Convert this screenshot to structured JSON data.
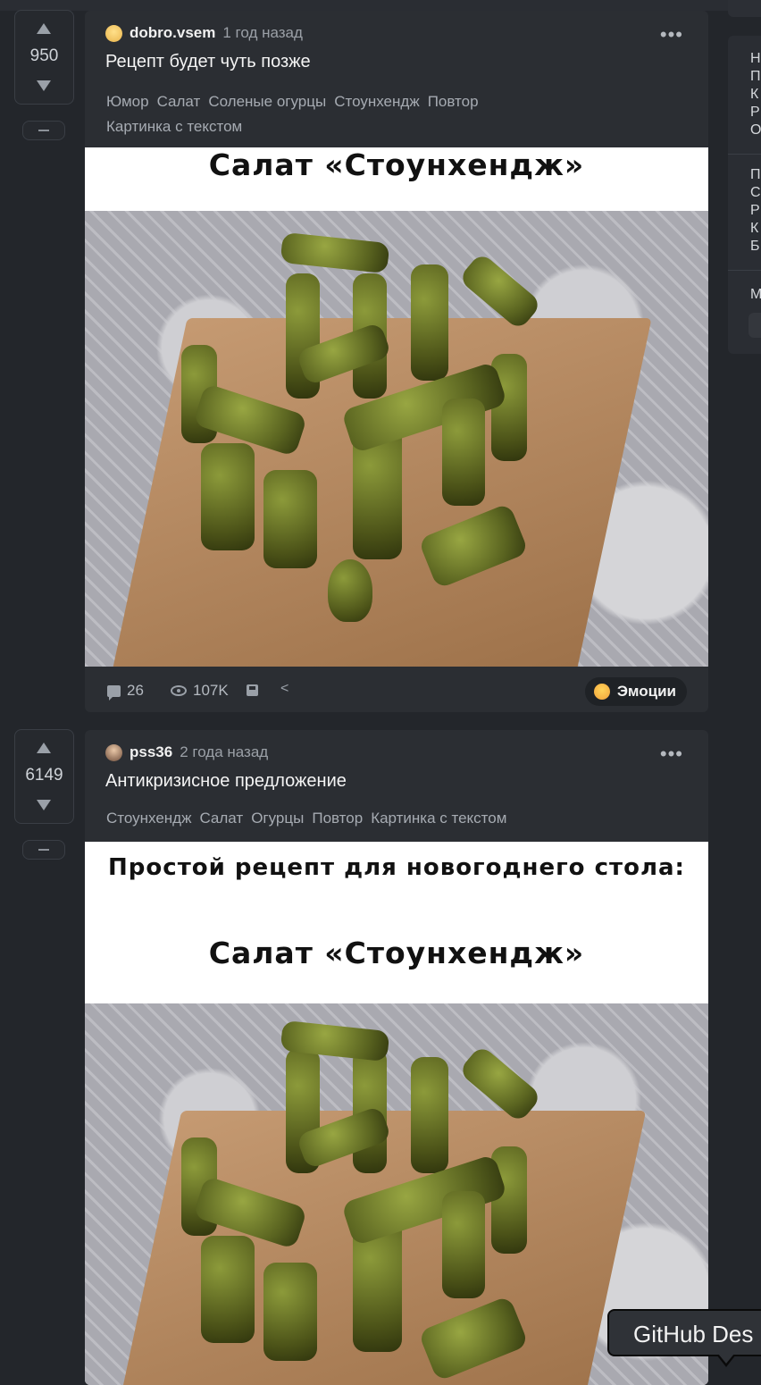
{
  "sidebar": {
    "block1_letters": [
      "Н",
      "П",
      "К",
      "Р",
      "О"
    ],
    "block2_letters": [
      "П",
      "С",
      "Р",
      "К",
      "Б"
    ],
    "block3_letters": [
      "М"
    ]
  },
  "posts": [
    {
      "score": "950",
      "author": "dobro.vsem",
      "date": "1 год назад",
      "title": "Рецепт будет чуть позже",
      "tags": [
        "Юмор",
        "Салат",
        "Соленые огурцы",
        "Стоунхендж",
        "Повтор",
        "Картинка с текстом"
      ],
      "image_caption_main": "Салат «Стоунхендж»",
      "comments": "26",
      "views": "107K",
      "emotions_label": "Эмоции"
    },
    {
      "score": "6149",
      "author": "pss36",
      "date": "2 года назад",
      "title": "Антикризисное предложение",
      "tags": [
        "Стоунхендж",
        "Салат",
        "Огурцы",
        "Повтор",
        "Картинка с текстом"
      ],
      "image_caption_top": "Простой рецепт для новогоднего стола:",
      "image_caption_main": "Салат «Стоунхендж»"
    }
  ],
  "tooltip": {
    "text": "GitHub Des"
  },
  "icons": [
    "upvote-icon",
    "downvote-icon",
    "more-icon",
    "comment-icon",
    "views-icon",
    "save-icon",
    "share-icon",
    "emoji-icon"
  ],
  "colors": {
    "background": "#23262b",
    "card": "#2b2e33",
    "text": "#e6e6e6",
    "muted": "#9ba0a7"
  }
}
